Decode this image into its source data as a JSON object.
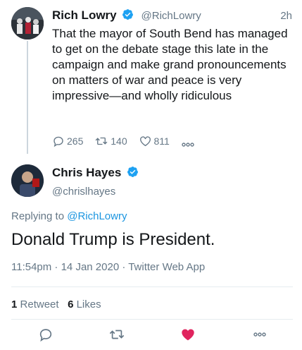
{
  "parent_tweet": {
    "name": "Rich Lowry",
    "handle": "@RichLowry",
    "time": "2h",
    "text": "That the mayor of South Bend has managed to get on the debate stage this late in the campaign and make grand pronouncements on matters of war and peace is very impressive—and wholly ridiculous",
    "replies": "265",
    "retweets": "140",
    "likes": "811"
  },
  "main_tweet": {
    "name": "Chris Hayes",
    "handle": "@chrislhayes",
    "replying_label": "Replying to",
    "replying_handle": "@RichLowry",
    "text": "Donald Trump is President.",
    "meta": "11:54pm · 14 Jan 2020 · Twitter Web App",
    "retweet_count": "1",
    "retweet_label": "Retweet",
    "like_count": "6",
    "like_label": "Likes"
  },
  "colors": {
    "accent": "#1b95e0",
    "like": "#e0245e",
    "muted": "#657786"
  }
}
